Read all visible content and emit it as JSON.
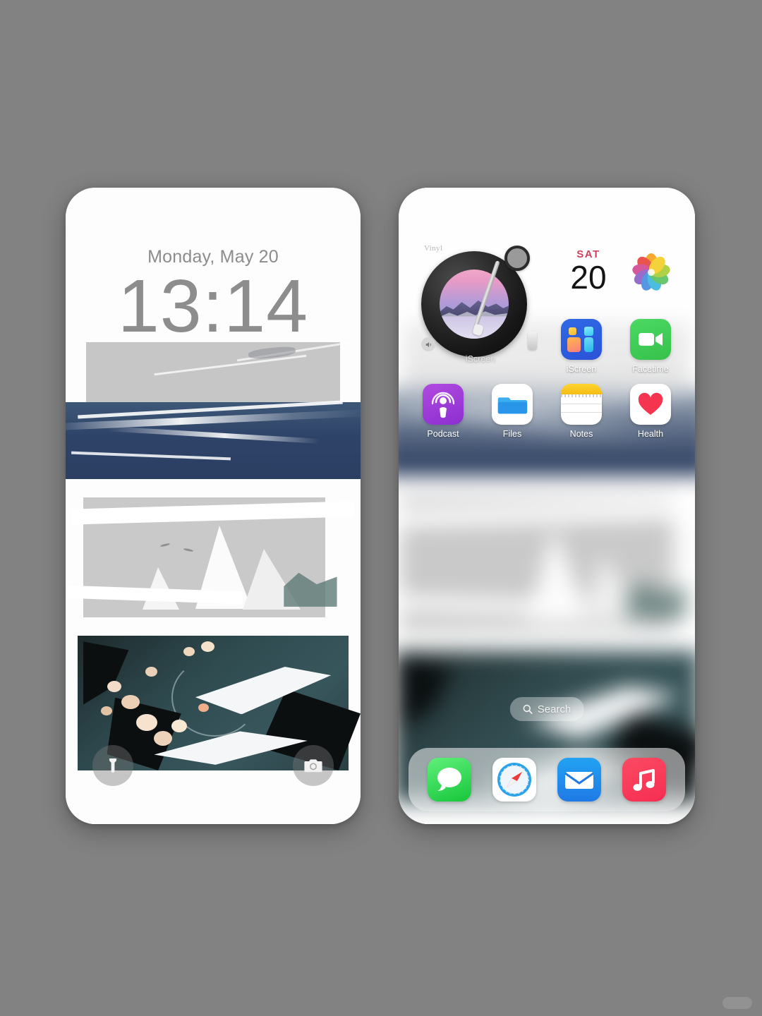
{
  "background_color": "#828282",
  "lock_screen": {
    "name": "lock-screen",
    "date": "Monday, May 20",
    "time": "13:14",
    "buttons": [
      {
        "name": "flashlight-button",
        "icon": "flashlight-icon",
        "label": "Flashlight"
      },
      {
        "name": "camera-button",
        "icon": "camera-icon",
        "label": "Camera"
      }
    ]
  },
  "home_screen": {
    "name": "home-screen",
    "widgets": {
      "vinyl": {
        "title": "Vinyl",
        "caption": "iScreen",
        "album_art": "sunset-mountain-lake",
        "controls": [
          "volume-icon",
          "slider-handle"
        ]
      },
      "calendar": {
        "day_of_week": "SAT",
        "day": "20",
        "dow_color": "#d0415d",
        "day_color": "#141414"
      },
      "photos": {
        "name": "photos-widget",
        "icon": "photos-flower-icon",
        "petal_colors": [
          "#f3b72e",
          "#f58220",
          "#e8483f",
          "#d0509a",
          "#8e63c8",
          "#4a90e2",
          "#3fb8e0",
          "#5dc264",
          "#a6ce3a"
        ]
      }
    },
    "app_rows": [
      [
        {
          "name": "app-iscreen",
          "label": "iScreen",
          "icon": "iscreen-icon",
          "color": "#2f6ae6"
        },
        {
          "name": "app-facetime",
          "label": "Facetime",
          "icon": "facetime-icon",
          "color": "#4cd964"
        }
      ],
      [
        {
          "name": "app-podcast",
          "label": "Podcast",
          "icon": "podcast-icon",
          "color": "#b14ae0"
        },
        {
          "name": "app-files",
          "label": "Files",
          "icon": "files-folder-icon",
          "color": "#2f9ae8"
        },
        {
          "name": "app-notes",
          "label": "Notes",
          "icon": "notes-icon",
          "color": "#f7c325"
        },
        {
          "name": "app-health",
          "label": "Health",
          "icon": "health-heart-icon",
          "color": "#f53a5c"
        }
      ]
    ],
    "search": {
      "label": "Search",
      "icon": "search-icon"
    },
    "dock": [
      {
        "name": "dock-messages",
        "label": "Messages",
        "icon": "messages-icon",
        "color": "#35c14a"
      },
      {
        "name": "dock-safari",
        "label": "Safari",
        "icon": "safari-compass-icon",
        "color": "#1f8fe0"
      },
      {
        "name": "dock-mail",
        "label": "Mail",
        "icon": "mail-envelope-icon",
        "color": "#1f7ae5"
      },
      {
        "name": "dock-music",
        "label": "Music",
        "icon": "music-note-icon",
        "color": "#f62e52"
      }
    ]
  }
}
